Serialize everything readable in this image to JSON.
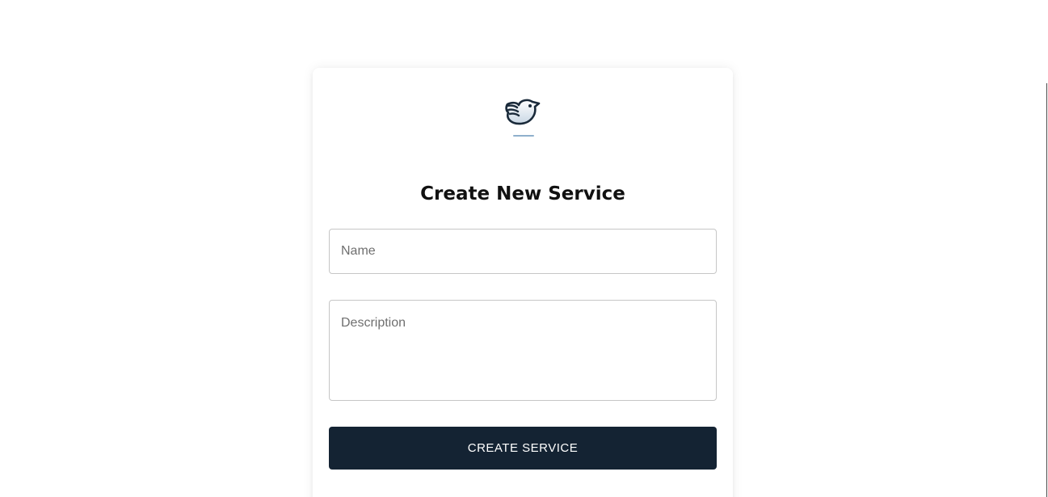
{
  "form": {
    "title": "Create New Service",
    "logo_icon": "bird-logo-icon",
    "name_placeholder": "Name",
    "name_value": "",
    "description_placeholder": "Description",
    "description_value": "",
    "submit_label": "CREATE SERVICE"
  },
  "colors": {
    "button_background": "#142333",
    "button_text": "#ffffff",
    "logo_dark": "#1a2a3a",
    "logo_accent": "#8fb0cc"
  }
}
